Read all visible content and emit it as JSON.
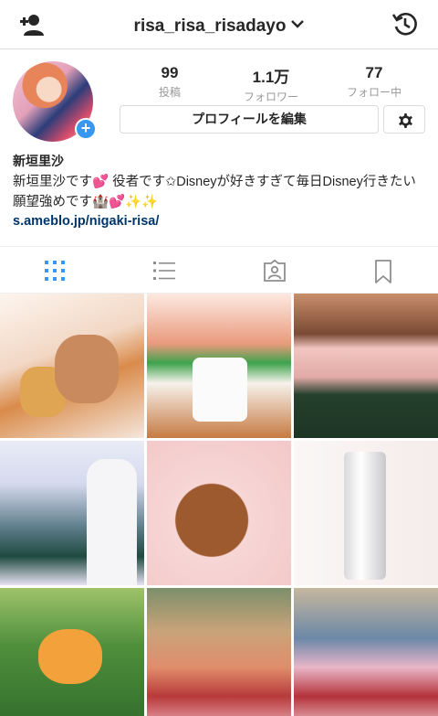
{
  "header": {
    "username": "risa_risa_risadayo",
    "add_user_icon": "add-user-icon",
    "history_icon": "history-icon"
  },
  "profile": {
    "stats": [
      {
        "value": "99",
        "label": "投稿"
      },
      {
        "value": "1.1万",
        "label": "フォロワー"
      },
      {
        "value": "77",
        "label": "フォロー中"
      }
    ],
    "edit_label": "プロフィールを編集",
    "name": "新垣里沙",
    "bio": "新垣里沙です💕 役者です✩Disneyが好きすぎて毎日Disney行きたい願望強めです🏰💕✨✨",
    "link": "s.ameblo.jp/nigaki-risa/"
  },
  "tabs": [
    "grid-view-icon",
    "list-view-icon",
    "tagged-photos-icon",
    "saved-icon"
  ],
  "colors": {
    "accent": "#3897f0",
    "link": "#003569",
    "muted": "#999999",
    "border": "#dbdbdb"
  }
}
